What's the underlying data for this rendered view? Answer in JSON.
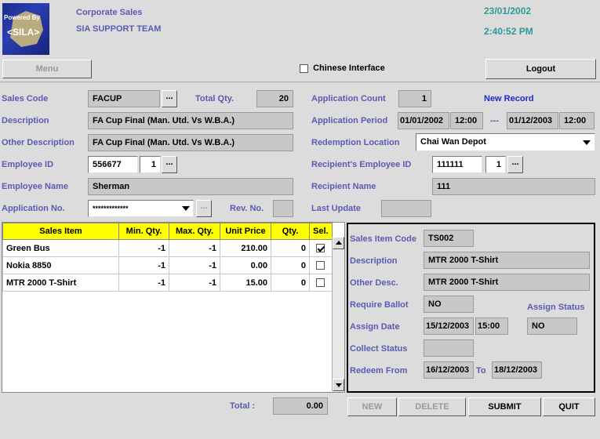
{
  "header": {
    "logo_text_top": "Powered By",
    "logo_text_main": "<SILA>",
    "app_name": "Corporate Sales",
    "team_name": "SIA SUPPORT TEAM",
    "date": "23/01/2002",
    "time": "2:40:52 PM"
  },
  "toolbar": {
    "menu_label": "Menu",
    "chinese_label": "Chinese Interface",
    "chinese_checked": false,
    "logout_label": "Logout"
  },
  "form": {
    "sales_code_label": "Sales Code",
    "sales_code": "FACUP",
    "total_qty_label": "Total Qty.",
    "total_qty": "20",
    "description_label": "Description",
    "description": "FA Cup Final (Man. Utd. Vs W.B.A.)",
    "other_description_label": "Other Description",
    "other_description": "FA Cup Final (Man. Utd. Vs W.B.A.)",
    "employee_id_label": "Employee ID",
    "employee_id": "556677",
    "employee_id_suffix": "1",
    "employee_name_label": "Employee Name",
    "employee_name": "Sherman",
    "application_no_label": "Application No.",
    "application_no": "*************",
    "rev_no_label": "Rev. No.",
    "rev_no": "",
    "application_count_label": "Application Count",
    "application_count": "1",
    "new_record_label": "New Record",
    "application_period_label": "Application Period",
    "period_from_date": "01/01/2002",
    "period_from_time": "12:00",
    "period_sep": "---",
    "period_to_date": "01/12/2003",
    "period_to_time": "12:00",
    "redemption_location_label": "Redemption Location",
    "redemption_location": "Chai Wan Depot",
    "recipient_employee_id_label": "Recipient's Employee ID",
    "recipient_employee_id": "111111",
    "recipient_employee_id_suffix": "1",
    "recipient_name_label": "Recipient Name",
    "recipient_name": "111",
    "last_update_label": "Last Update",
    "last_update": "",
    "dots_label": "..."
  },
  "grid": {
    "headers": [
      "Sales Item",
      "Min. Qty.",
      "Max. Qty.",
      "Unit Price",
      "Qty.",
      "Sel."
    ],
    "rows": [
      {
        "item": "Green Bus",
        "min": "-1",
        "max": "-1",
        "price": "210.00",
        "qty": "0",
        "sel": true
      },
      {
        "item": "Nokia 8850",
        "min": "-1",
        "max": "-1",
        "price": "0.00",
        "qty": "0",
        "sel": false
      },
      {
        "item": "MTR 2000 T-Shirt",
        "min": "-1",
        "max": "-1",
        "price": "15.00",
        "qty": "0",
        "sel": false
      }
    ]
  },
  "detail": {
    "code_label": "Sales Item Code",
    "code": "TS002",
    "description_label": "Description",
    "description": "MTR 2000 T-Shirt",
    "other_desc_label": "Other Desc.",
    "other_desc": "MTR 2000 T-Shirt",
    "require_ballot_label": "Require Ballot",
    "require_ballot": "NO",
    "assign_status_label": "Assign Status",
    "assign_status": "NO",
    "assign_date_label": "Assign Date",
    "assign_date": "15/12/2003",
    "assign_time": "15:00",
    "collect_status_label": "Collect Status",
    "collect_status": "",
    "redeem_from_label": "Redeem From",
    "redeem_from": "16/12/2003",
    "to_label": "To",
    "redeem_to": "18/12/2003"
  },
  "footer": {
    "total_label": "Total :",
    "total": "0.00",
    "new_label": "NEW",
    "delete_label": "DELETE",
    "submit_label": "SUBMIT",
    "quit_label": "QUIT"
  }
}
